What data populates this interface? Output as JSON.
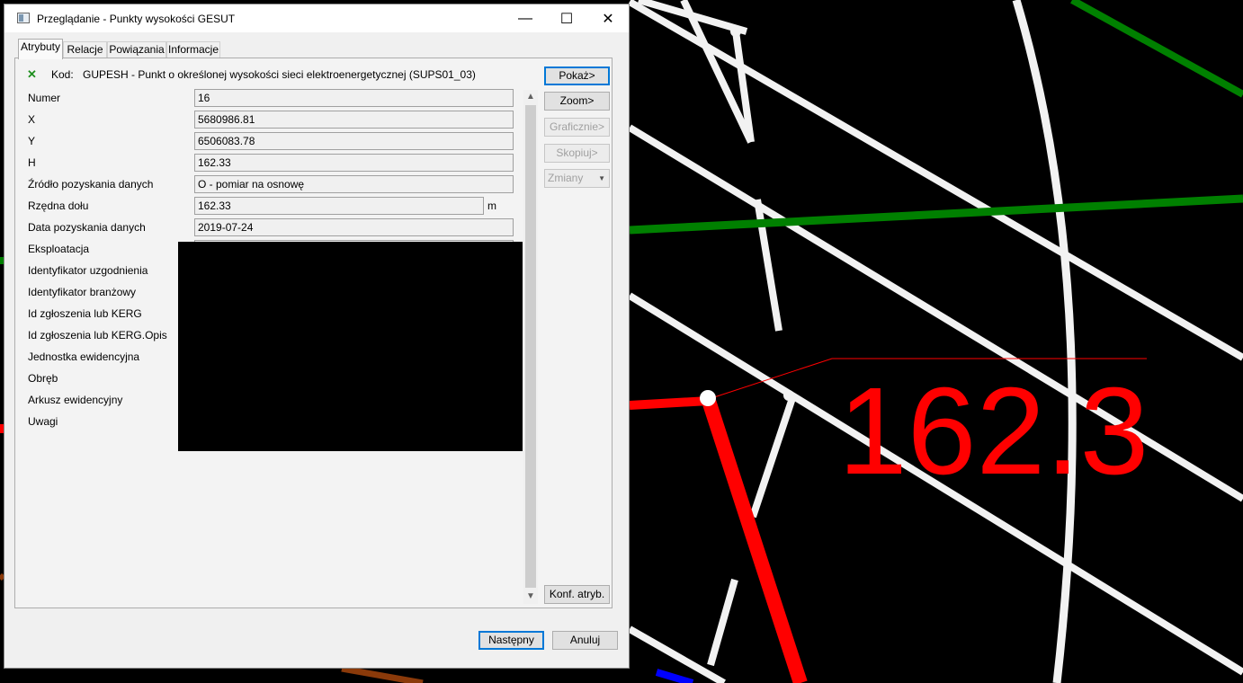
{
  "window": {
    "title": "Przeglądanie - Punkty wysokości GESUT",
    "minimize": "—",
    "maximize": "☐",
    "close": "✕"
  },
  "tabs": [
    "Atrybuty",
    "Relacje",
    "Powiązania",
    "Informacje"
  ],
  "kod": {
    "icon": "✕",
    "label": "Kod:",
    "value": "GUPESH - Punkt o określonej wysokości sieci elektroenergetycznej (SUPS01_03)"
  },
  "fields": [
    {
      "label": "Numer",
      "value": "16"
    },
    {
      "label": "X",
      "value": "5680986.81"
    },
    {
      "label": "Y",
      "value": "6506083.78"
    },
    {
      "label": "H",
      "value": "162.33"
    },
    {
      "label": "Źródło pozyskania danych",
      "value": "O - pomiar na osnowę"
    },
    {
      "label": "Rzędna dołu",
      "value": "162.33",
      "unit": "m"
    },
    {
      "label": "Data pozyskania danych",
      "value": "2019-07-24"
    },
    {
      "label": "Eksploatacja",
      "value": ""
    },
    {
      "label": "Identyfikator uzgodnienia",
      "value": ""
    },
    {
      "label": "Identyfikator branżowy",
      "value": ""
    },
    {
      "label": "Id zgłoszenia lub KERG",
      "value": ""
    },
    {
      "label": "Id zgłoszenia lub KERG.Opis",
      "value": ""
    },
    {
      "label": "Jednostka ewidencyjna",
      "value": ""
    },
    {
      "label": "Obręb",
      "value": ""
    },
    {
      "label": "Arkusz ewidencyjny",
      "value": ""
    },
    {
      "label": "Uwagi",
      "value": ""
    }
  ],
  "side_buttons": {
    "pokaz": "Pokaż>",
    "zoom": "Zoom>",
    "graficznie": "Graficznie>",
    "skopiuj": "Skopiuj>",
    "zmiany": "Zmiany",
    "konf": "Konf. atryb."
  },
  "bottom_buttons": {
    "nastepny": "Następny",
    "anuluj": "Anuluj"
  },
  "scroll": {
    "up": "▲",
    "down": "▼"
  },
  "cad_view": {
    "label_text": "162.3",
    "colors": {
      "background": "#000000",
      "lines": "#f2f2f2",
      "green": "#008000",
      "red": "#ff0000",
      "brown": "#8b3a0a",
      "blue": "#0000ff"
    }
  }
}
